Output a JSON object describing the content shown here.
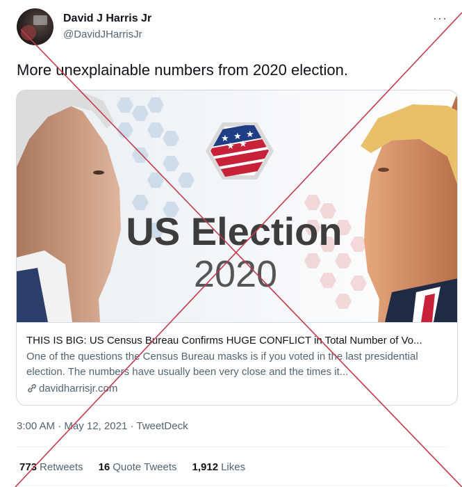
{
  "author": {
    "name": "David J Harris Jr",
    "handle": "@DavidJHarrisJr",
    "avatar_icon": "profile-photo-avatar"
  },
  "more_icon": "more-options-icon",
  "more_glyph": "···",
  "tweet": {
    "text": "More unexplainable numbers from 2020 election."
  },
  "card": {
    "image": {
      "line1": "US Election",
      "line2": "2020",
      "emblem_icon": "us-flag-hexagon-emblem"
    },
    "title": "THIS IS BIG: US Census Bureau Confirms HUGE CONFLICT in Total Number of Vo...",
    "description": "One of the questions the Census Bureau masks is if you voted in the last presidential election. The numbers have usually been very close and the times it...",
    "domain": "davidharrisjr.com",
    "link_icon": "link-icon"
  },
  "meta": {
    "time": "3:00 AM",
    "sep1": "·",
    "date": "May 12, 2021",
    "sep2": "·",
    "source": "TweetDeck"
  },
  "stats": {
    "retweets_count": "773",
    "retweets_label": "Retweets",
    "quote_count": "16",
    "quote_label": "Quote Tweets",
    "likes_count": "1,912",
    "likes_label": "Likes"
  },
  "colors": {
    "cross": "#c23a4a",
    "text": "#0f1419",
    "secondary": "#536471",
    "border": "#cfd9de",
    "election_text": "#3d3d3d",
    "flag_red": "#c8213a",
    "flag_blue": "#1e3d85"
  }
}
